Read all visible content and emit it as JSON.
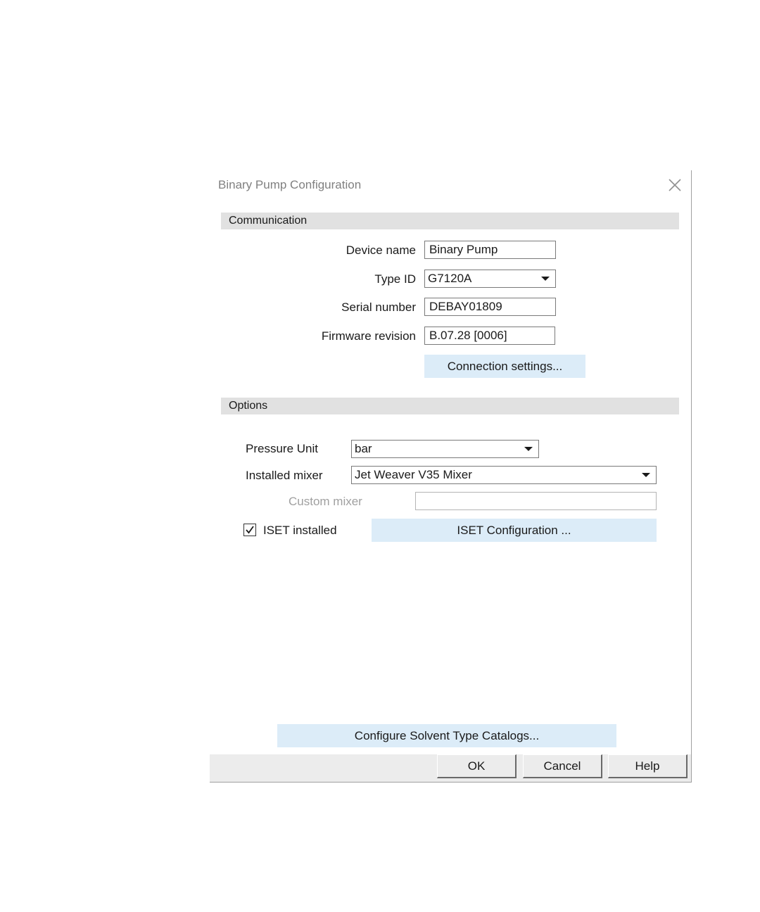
{
  "dialog": {
    "title": "Binary Pump Configuration",
    "close_icon": "close-icon"
  },
  "communication": {
    "header": "Communication",
    "device_name_label": "Device name",
    "device_name_value": "Binary Pump",
    "type_id_label": "Type ID",
    "type_id_value": "G7120A",
    "serial_number_label": "Serial number",
    "serial_number_value": "DEBAY01809",
    "firmware_label": "Firmware revision",
    "firmware_value": "B.07.28 [0006]",
    "connection_settings_label": "Connection settings..."
  },
  "options": {
    "header": "Options",
    "pressure_unit_label": "Pressure Unit",
    "pressure_unit_value": "bar",
    "installed_mixer_label": "Installed mixer",
    "installed_mixer_value": "Jet Weaver V35 Mixer",
    "custom_mixer_label": "Custom mixer",
    "custom_mixer_value": "",
    "iset_installed_label": "ISET installed",
    "iset_installed_checked": true,
    "iset_configuration_label": "ISET Configuration ..."
  },
  "catalogs_button_label": "Configure Solvent Type Catalogs...",
  "footer": {
    "ok_label": "OK",
    "cancel_label": "Cancel",
    "help_label": "Help"
  }
}
